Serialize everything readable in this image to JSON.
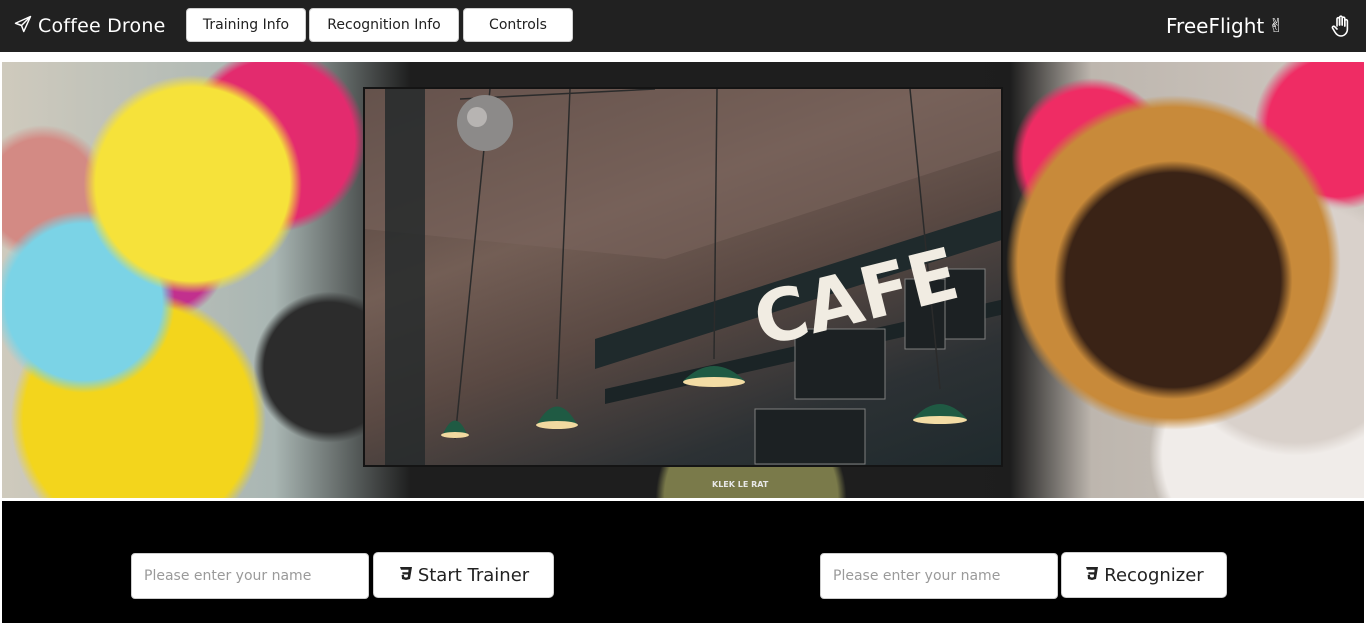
{
  "header": {
    "brand_label": "Coffee Drone",
    "nav": {
      "training_info": "Training Info",
      "recognition_info": "Recognition Info",
      "controls": "Controls"
    },
    "freeflight_label": "FreeFlight",
    "peace_icon": "✌",
    "icons": [
      "paper-plane-icon",
      "peace-hand-icon",
      "raised-hand-icon"
    ]
  },
  "hero": {
    "photo_sign_text": "CAFE",
    "wall_tag_text": "KLEK LE RAT"
  },
  "trainer": {
    "placeholder": "Please enter your name",
    "button_label": "Start Trainer"
  },
  "recognizer": {
    "placeholder": "Please enter your name",
    "button_label": "Recognizer"
  },
  "colors": {
    "topbar": "#212121",
    "bottom": "#000000",
    "button_bg": "#ffffff"
  }
}
